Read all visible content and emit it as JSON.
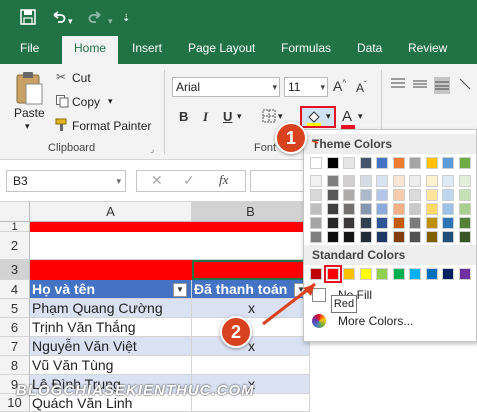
{
  "qat": {
    "save_icon": "save-icon",
    "undo_icon": "undo-icon",
    "redo_icon": "redo-icon"
  },
  "tabs": [
    "File",
    "Home",
    "Insert",
    "Page Layout",
    "Formulas",
    "Data",
    "Review"
  ],
  "active_tab": "Home",
  "clipboard": {
    "paste_label": "Paste",
    "cut_label": "Cut",
    "copy_label": "Copy",
    "format_painter_label": "Format Painter",
    "group_label": "Clipboard"
  },
  "font": {
    "name": "Arial",
    "size": "11",
    "group_label": "Font",
    "bold": "B",
    "italic": "I",
    "underline": "U",
    "font_color_letter": "A"
  },
  "formula_bar": {
    "name_box": "B3",
    "fx": "fx"
  },
  "columns": [
    "A",
    "B"
  ],
  "rows": [
    "1",
    "2",
    "3",
    "4",
    "5",
    "6",
    "7",
    "8",
    "9",
    "10"
  ],
  "table": {
    "header_name": "Họ và tên",
    "header_paid": "Đã thanh toán",
    "names": [
      "Phạm Quang Cường",
      "Trịnh Văn Thắng",
      "Nguyễn Văn Việt",
      "Vũ Văn Tùng",
      "Lê Đình Trung",
      "Quách Văn Linh"
    ],
    "paid": [
      "x",
      "",
      "x",
      "",
      "x",
      ""
    ]
  },
  "palette": {
    "theme_title": "Theme Colors",
    "standard_title": "Standard Colors",
    "no_fill": "No Fill",
    "more_colors": "More Colors...",
    "tooltip": "Red",
    "theme_top": [
      "#ffffff",
      "#000000",
      "#e7e6e6",
      "#44546a",
      "#4472c4",
      "#ed7d31",
      "#a5a5a5",
      "#ffc000",
      "#5b9bd5",
      "#70ad47"
    ],
    "theme_shades": [
      [
        "#f2f2f2",
        "#7f7f7f",
        "#d0cece",
        "#d6dce4",
        "#d9e2f3",
        "#fbe5d5",
        "#ededed",
        "#fff2cc",
        "#deebf6",
        "#e2efd9"
      ],
      [
        "#d8d8d8",
        "#595959",
        "#aeabab",
        "#adb9ca",
        "#b4c6e7",
        "#f7cbac",
        "#dbdbdb",
        "#fee599",
        "#bdd7ee",
        "#c5e0b3"
      ],
      [
        "#bfbfbf",
        "#3f3f3f",
        "#757070",
        "#8496b0",
        "#8eaadb",
        "#f4b183",
        "#c9c9c9",
        "#ffd965",
        "#9cc3e5",
        "#a8d08d"
      ],
      [
        "#a5a5a5",
        "#262626",
        "#3a3838",
        "#323f4f",
        "#2f5496",
        "#c55a11",
        "#7b7b7b",
        "#bf9000",
        "#2e75b5",
        "#538135"
      ],
      [
        "#7f7f7f",
        "#0c0c0c",
        "#171616",
        "#222a35",
        "#1f3864",
        "#833c0b",
        "#525252",
        "#7f6000",
        "#1e4e79",
        "#375623"
      ]
    ],
    "standard": [
      "#c00000",
      "#ff0000",
      "#ffc000",
      "#ffff00",
      "#92d050",
      "#00b050",
      "#00b0f0",
      "#0070c0",
      "#002060",
      "#7030a0"
    ]
  },
  "callouts": [
    "1",
    "2"
  ],
  "watermark": "BLOGCHIASEKIENTHUC.COM",
  "colors": {
    "excel_green": "#217346",
    "header_blue": "#4472c4",
    "band_blue": "#d9e1f2",
    "red_band": "#ff0000",
    "callout": "#d9421e"
  }
}
